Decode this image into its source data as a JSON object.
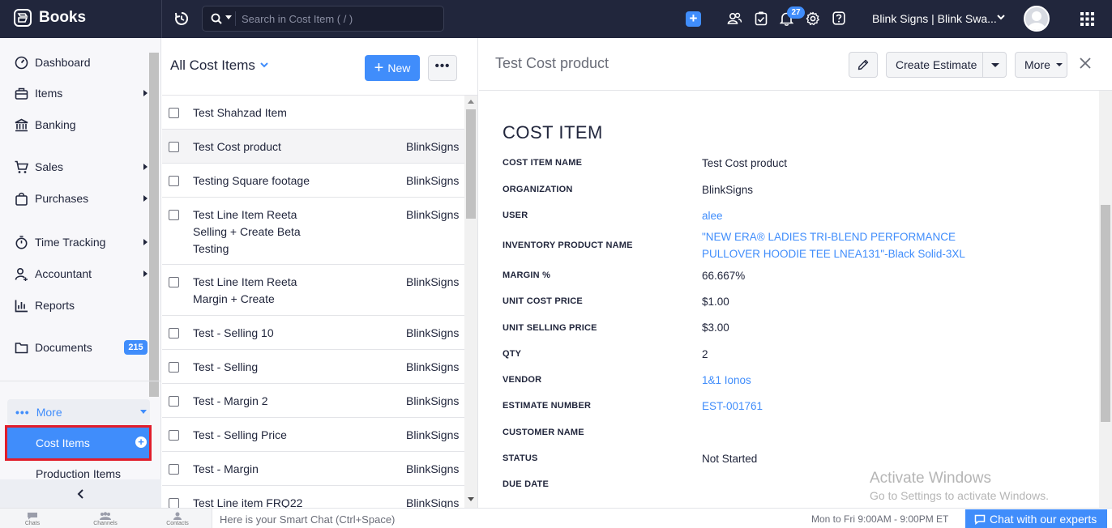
{
  "app": {
    "name": "Books",
    "search_placeholder": "Search in Cost Item ( / )",
    "notification_count": "27",
    "org_name": "Blink Signs | Blink Swa..."
  },
  "sidebar": {
    "items": [
      {
        "label": "Dashboard",
        "icon": "dashboard-icon"
      },
      {
        "label": "Items",
        "icon": "items-icon"
      },
      {
        "label": "Banking",
        "icon": "bank-icon"
      },
      {
        "label": "Sales",
        "icon": "cart-icon"
      },
      {
        "label": "Purchases",
        "icon": "bag-icon"
      },
      {
        "label": "Time Tracking",
        "icon": "stopwatch-icon"
      },
      {
        "label": "Accountant",
        "icon": "accountant-icon"
      },
      {
        "label": "Reports",
        "icon": "reports-icon"
      },
      {
        "label": "Documents",
        "icon": "folder-icon",
        "count": "215"
      }
    ],
    "more_label": "More",
    "more_dots": "•••",
    "active_item": "Cost Items",
    "sub_item": "Production Items"
  },
  "list": {
    "title": "All Cost Items",
    "new_label": "New",
    "more_dots": "•••",
    "rows": [
      {
        "name": "Test Shahzad Item",
        "org": ""
      },
      {
        "name": "Test Cost product",
        "org": "BlinkSigns"
      },
      {
        "name": "Testing Square footage",
        "org": "BlinkSigns"
      },
      {
        "name": "Test Line Item Reeta Selling + Create Beta Testing",
        "org": "BlinkSigns"
      },
      {
        "name": "Test Line Item Reeta Margin + Create",
        "org": "BlinkSigns"
      },
      {
        "name": "Test - Selling 10",
        "org": "BlinkSigns"
      },
      {
        "name": "Test - Selling",
        "org": "BlinkSigns"
      },
      {
        "name": "Test - Margin 2",
        "org": "BlinkSigns"
      },
      {
        "name": "Test - Selling Price",
        "org": "BlinkSigns"
      },
      {
        "name": "Test - Margin",
        "org": "BlinkSigns"
      },
      {
        "name": "Test Line item FRQ22",
        "org": "BlinkSigns"
      }
    ]
  },
  "detail": {
    "title": "Test Cost product",
    "create_estimate_label": "Create Estimate",
    "more_label": "More",
    "section_title": "COST ITEM",
    "fields": [
      {
        "label": "COST ITEM NAME",
        "value": "Test Cost product"
      },
      {
        "label": "ORGANIZATION",
        "value": "BlinkSigns"
      },
      {
        "label": "USER",
        "value": "alee"
      },
      {
        "label": "INVENTORY PRODUCT NAME",
        "value": "\"NEW ERA® LADIES TRI-BLEND PERFORMANCE PULLOVER HOODIE TEE LNEA131\"-Black Solid-3XL"
      },
      {
        "label": "MARGIN %",
        "value": "66.667%"
      },
      {
        "label": "UNIT COST PRICE",
        "value": "$1.00"
      },
      {
        "label": "UNIT SELLING PRICE",
        "value": "$3.00"
      },
      {
        "label": "QTY",
        "value": "2"
      },
      {
        "label": "VENDOR",
        "value": "1&1 Ionos"
      },
      {
        "label": "ESTIMATE NUMBER",
        "value": "EST-001761"
      },
      {
        "label": "CUSTOMER NAME",
        "value": ""
      },
      {
        "label": "STATUS",
        "value": "Not Started"
      },
      {
        "label": "DUE DATE",
        "value": ""
      }
    ]
  },
  "watermark": {
    "line1": "Activate Windows",
    "line2": "Go to Settings to activate Windows."
  },
  "bottombar": {
    "chats": "Chats",
    "channels": "Channels",
    "contacts": "Contacts",
    "smart_chat_placeholder": "Here is your Smart Chat (Ctrl+Space)",
    "hours": "Mon to Fri 9:00AM - 9:00PM ET",
    "chat_button": "Chat with our experts"
  },
  "colors": {
    "topbar": "#21263c",
    "accent": "#408dfb",
    "highlight_border": "#e11d2b"
  }
}
